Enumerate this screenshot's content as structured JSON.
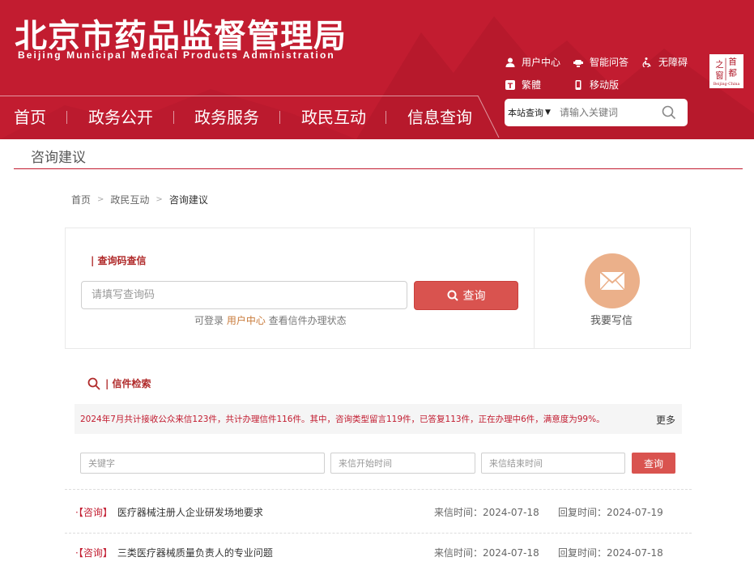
{
  "header": {
    "title": "北京市药品监督管理局",
    "subtitle": "Beijing Municipal Medical Products Administration",
    "top_links": [
      {
        "label": "用户中心",
        "icon": "user-icon"
      },
      {
        "label": "智能问答",
        "icon": "robot-icon"
      },
      {
        "label": "无障碍",
        "icon": "accessibility-icon"
      },
      {
        "label": "繁體",
        "icon": "traditional-chinese-icon"
      },
      {
        "label": "移动版",
        "icon": "mobile-icon"
      }
    ],
    "logo": {
      "chars": [
        "首",
        "都",
        "之",
        "窗"
      ],
      "caption": "Beijing-China"
    }
  },
  "nav": {
    "items": [
      "首页",
      "政务公开",
      "政务服务",
      "政民互动",
      "信息查询"
    ]
  },
  "search": {
    "scope": "本站查询",
    "placeholder": "请输入关键词"
  },
  "page": {
    "section_title": "咨询建议",
    "breadcrumb": [
      "首页",
      "政民互动",
      "咨询建议"
    ]
  },
  "query": {
    "label": "| 查询码查信",
    "placeholder": "请填写查询码",
    "button": "查询",
    "hint_prefix": "可登录 ",
    "hint_link": "用户中心",
    "hint_suffix": " 查看信件办理状态",
    "write_label": "我要写信"
  },
  "letters": {
    "label": "| 信件检索",
    "stats": "2024年7月共计接收公众来信123件，共计办理信件116件。其中，咨询类型留言119件，已答复113件，正在办理中6件，满意度为99%。",
    "more": "更多",
    "filters": {
      "keyword_placeholder": "关键字",
      "start_placeholder": "来信开始时间",
      "end_placeholder": "来信结束时间",
      "button": "查询"
    },
    "items": [
      {
        "category": "·【咨询】",
        "title": "医疗器械注册人企业研发场地要求",
        "sent": "来信时间：2024-07-18",
        "replied": "回复时间：2024-07-19"
      },
      {
        "category": "·【咨询】",
        "title": "三类医疗器械质量负责人的专业问题",
        "sent": "来信时间：2024-07-18",
        "replied": "回复时间：2024-07-18"
      }
    ]
  },
  "colors": {
    "brand_red": "#c21c30",
    "button_red": "#d9534f",
    "mail_circle": "#ebb08a"
  }
}
